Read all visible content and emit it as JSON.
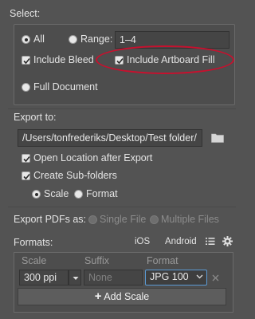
{
  "select": {
    "title": "Select:",
    "all_label": "All",
    "range_label": "Range:",
    "range_value": "1–4",
    "include_bleed": "Include Bleed",
    "include_artboard_fill": "Include Artboard Fill",
    "full_document": "Full Document"
  },
  "export_to": {
    "title": "Export to:",
    "path": "/Users/tonfrederiks/Desktop/Test folder/",
    "open_location": "Open Location after Export",
    "create_subfolders": "Create Sub-folders",
    "scale_label": "Scale",
    "format_label": "Format"
  },
  "export_pdfs": {
    "title": "Export PDFs as:",
    "single_file": "Single File",
    "multiple_files": "Multiple Files"
  },
  "formats": {
    "title": "Formats:",
    "ios": "iOS",
    "android": "Android",
    "headers": {
      "scale": "Scale",
      "suffix": "Suffix",
      "format": "Format"
    },
    "row": {
      "scale": "300 ppi",
      "suffix_placeholder": "None",
      "format": "JPG 100"
    },
    "add_scale": "Add Scale"
  },
  "colors": {
    "highlight": "#c8102e",
    "background": "#535353"
  }
}
